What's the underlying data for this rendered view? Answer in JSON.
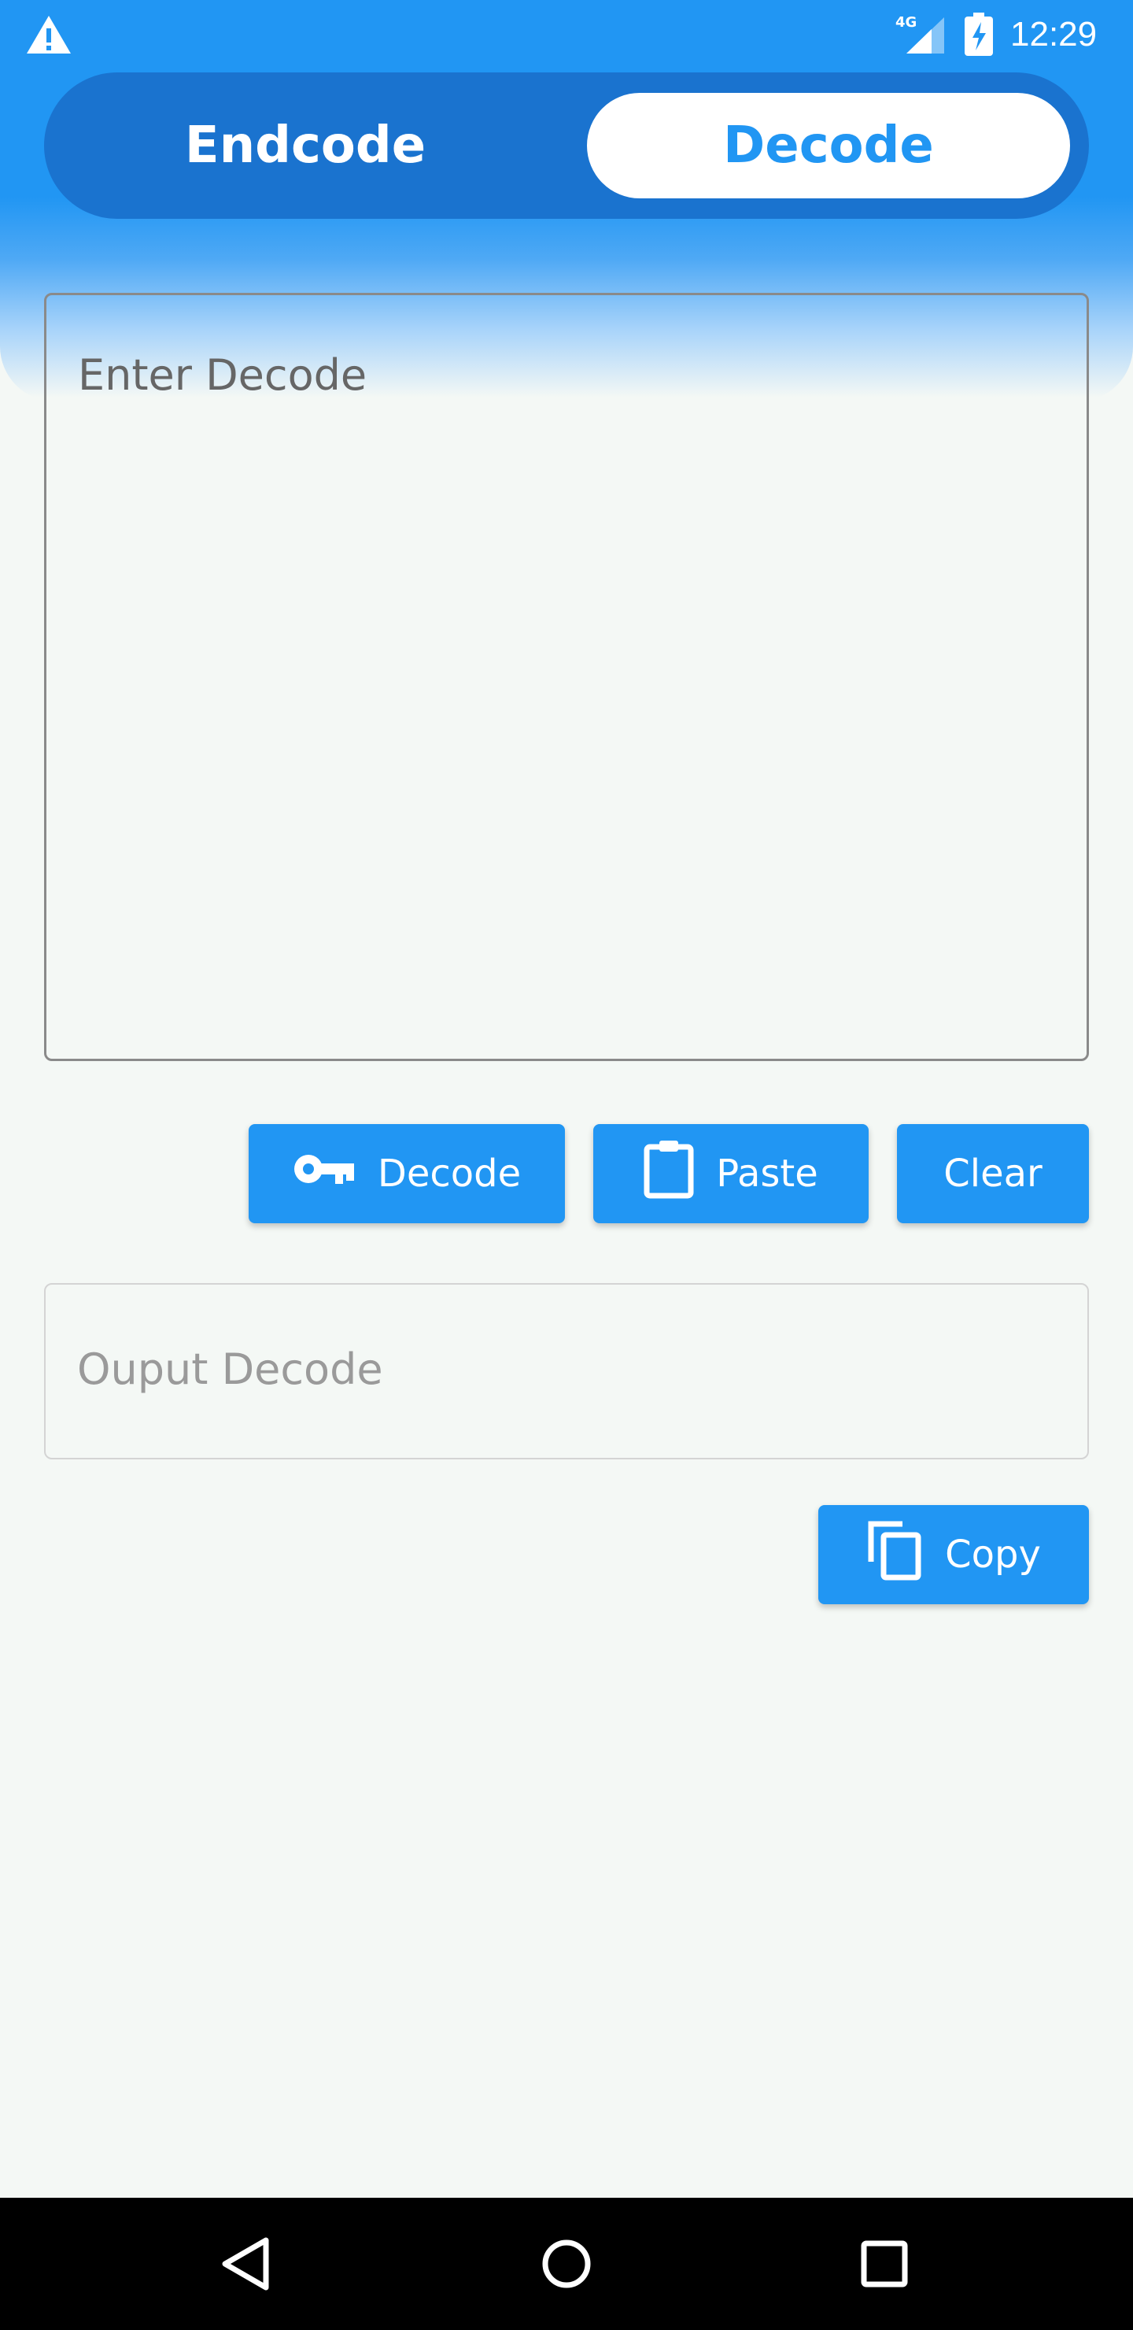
{
  "status_bar": {
    "time": "12:29",
    "network": "4G",
    "icons": [
      "warning-icon",
      "signal-icon",
      "battery-charging-icon"
    ]
  },
  "tabs": {
    "encode_label": "Endcode",
    "decode_label": "Decode",
    "selected": "Decode"
  },
  "input": {
    "placeholder": "Enter Decode",
    "value": ""
  },
  "actions": {
    "decode_label": "Decode",
    "decode_icon": "key-icon",
    "paste_label": "Paste",
    "paste_icon": "clipboard-icon",
    "clear_label": "Clear"
  },
  "output": {
    "placeholder": "Ouput Decode",
    "value": ""
  },
  "copy": {
    "label": "Copy",
    "icon": "copy-icon"
  },
  "nav": {
    "icons": [
      "back-icon",
      "home-icon",
      "recents-icon"
    ]
  },
  "colors": {
    "accent": "#2196F3",
    "accent_dark": "#1A73CF",
    "background": "#F4F8F5"
  }
}
